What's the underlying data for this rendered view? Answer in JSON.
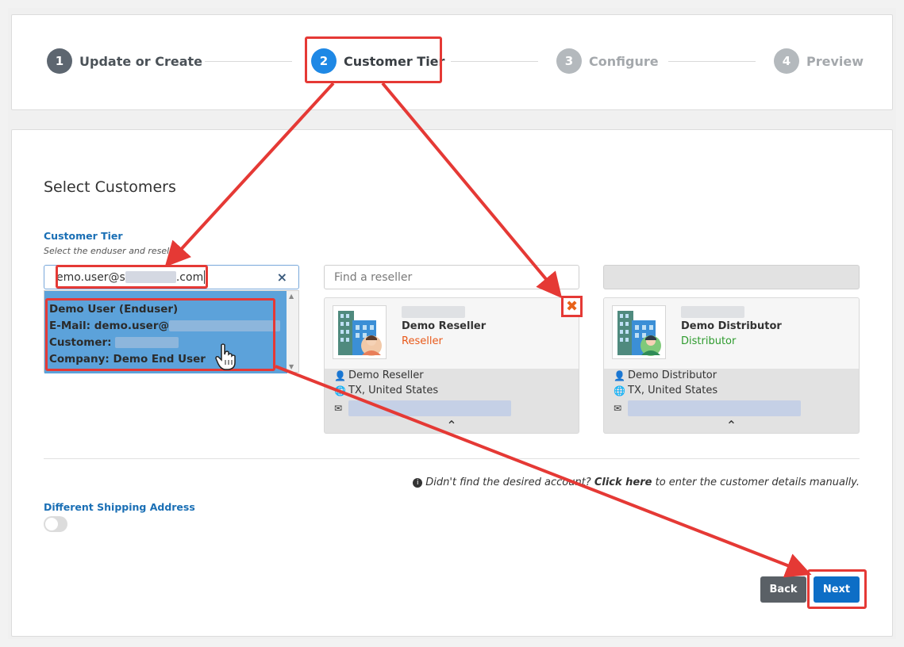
{
  "stepper": {
    "steps": [
      {
        "num": "1",
        "label": "Update or Create"
      },
      {
        "num": "2",
        "label": "Customer Tier"
      },
      {
        "num": "3",
        "label": "Configure"
      },
      {
        "num": "4",
        "label": "Preview"
      }
    ]
  },
  "section": {
    "title": "Select Customers",
    "field_label": "Customer Tier",
    "field_hint": "Select the enduser and reseller."
  },
  "customer_search": {
    "value_start": "emo.user@s",
    "value_end": ".com",
    "clear_icon": "×",
    "suggestion": {
      "line1": "Demo User (Enduser)",
      "line2": "E-Mail: demo.user@",
      "line3": "Customer:",
      "line4": "Company: Demo End User"
    }
  },
  "reseller": {
    "placeholder": "Find a reseller",
    "name": "Demo Reseller",
    "role": "Reseller",
    "role_color": "#e8591a",
    "contact": "Demo Reseller",
    "location": "TX, United States",
    "remove_icon": "✖"
  },
  "distributor": {
    "name": "Demo Distributor",
    "role": "Distributor",
    "role_color": "#2e9b2e",
    "contact": "Demo Distributor",
    "location": "TX, United States"
  },
  "manual": {
    "prefix": "Didn't find the desired account?",
    "link": "Click here",
    "suffix": "to enter the customer details manually."
  },
  "shipping": {
    "label": "Different Shipping Address",
    "enabled": false
  },
  "actions": {
    "back_label": "Back",
    "next_label": "Next"
  },
  "colors": {
    "accent": "#1e88e5",
    "annotation": "#e53935"
  }
}
